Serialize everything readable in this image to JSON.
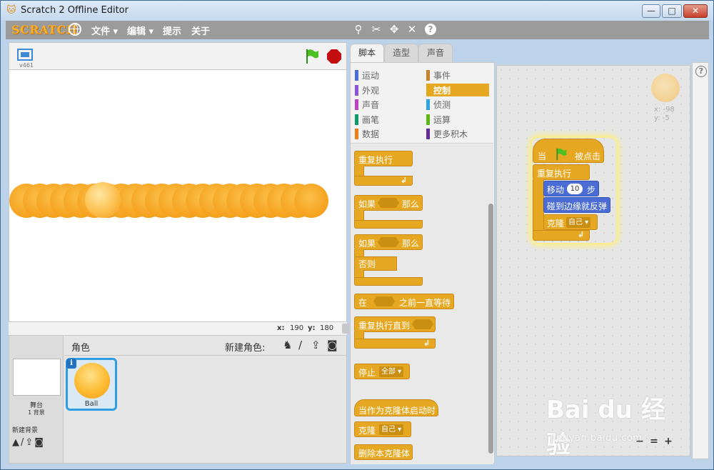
{
  "window": {
    "title": "Scratch 2 Offline Editor",
    "min": "—",
    "max": "□",
    "close": "✕"
  },
  "menubar": {
    "logo": "SCRATCH",
    "items": [
      {
        "label": "文件 ▾",
        "name": "file"
      },
      {
        "label": "编辑 ▾",
        "name": "edit"
      },
      {
        "label": "提示",
        "name": "tips"
      },
      {
        "label": "关于",
        "name": "about"
      }
    ],
    "tools": [
      "duplicate-icon",
      "delete-icon",
      "grow-icon",
      "shrink-icon",
      "help-icon"
    ],
    "help": "?"
  },
  "stage": {
    "version": "v461",
    "coords": {
      "x_label": "x:",
      "x_value": "190",
      "y_label": "y:",
      "y_value": "180"
    }
  },
  "sprites_pane": {
    "title": "角色",
    "new_sprite_label": "新建角色:",
    "stage_label": "舞台",
    "stage_backdrops": "1 背景",
    "new_backdrop_label": "新建背景",
    "sprite_name": "Ball",
    "info": "i"
  },
  "tabs": [
    {
      "label": "脚本",
      "active": true
    },
    {
      "label": "造型",
      "active": false
    },
    {
      "label": "声音",
      "active": false
    }
  ],
  "categories": [
    {
      "label": "运动",
      "color": "#4a6cd4"
    },
    {
      "label": "事件",
      "color": "#c88330"
    },
    {
      "label": "外观",
      "color": "#8a55d7"
    },
    {
      "label": "控制",
      "color": "#e1a91a",
      "selected": true
    },
    {
      "label": "声音",
      "color": "#bb42c3"
    },
    {
      "label": "侦测",
      "color": "#2ca5e2"
    },
    {
      "label": "画笔",
      "color": "#0e9a6c"
    },
    {
      "label": "运算",
      "color": "#5cb712"
    },
    {
      "label": "数据",
      "color": "#ee7d16"
    },
    {
      "label": "更多积木",
      "color": "#632d99"
    }
  ],
  "palette_blocks": {
    "forever": "重复执行",
    "if_then_if": "如果",
    "if_then_then": "那么",
    "if_else_if": "如果",
    "if_else_then": "那么",
    "if_else_else": "否则",
    "wait_until_pre": "在",
    "wait_until_post": "之前一直等待",
    "repeat_until": "重复执行直到",
    "stop": "停止",
    "stop_option": "全部 ▾",
    "when_clone": "当作为克隆体启动时",
    "create_clone": "克隆",
    "clone_option": "自己 ▾",
    "delete_clone": "删除本克隆体",
    "loop_arrow": "↲"
  },
  "script": {
    "hat_pre": "当",
    "hat_post": "被点击",
    "forever": "重复执行",
    "move_pre": "移动",
    "move_steps": "10",
    "move_post": "步",
    "bounce": "碰到边缘就反弹",
    "clone": "克隆",
    "clone_option": "自己 ▾",
    "loop_arrow": "↲"
  },
  "sprite_info": {
    "x": "x: -98",
    "y": "y: -5"
  },
  "zoom": {
    "out": "−",
    "reset": "=",
    "in": "+"
  },
  "side_help": "?",
  "watermark": {
    "brand": "Bai du 经验",
    "url": "jingyan.baidu.com"
  }
}
